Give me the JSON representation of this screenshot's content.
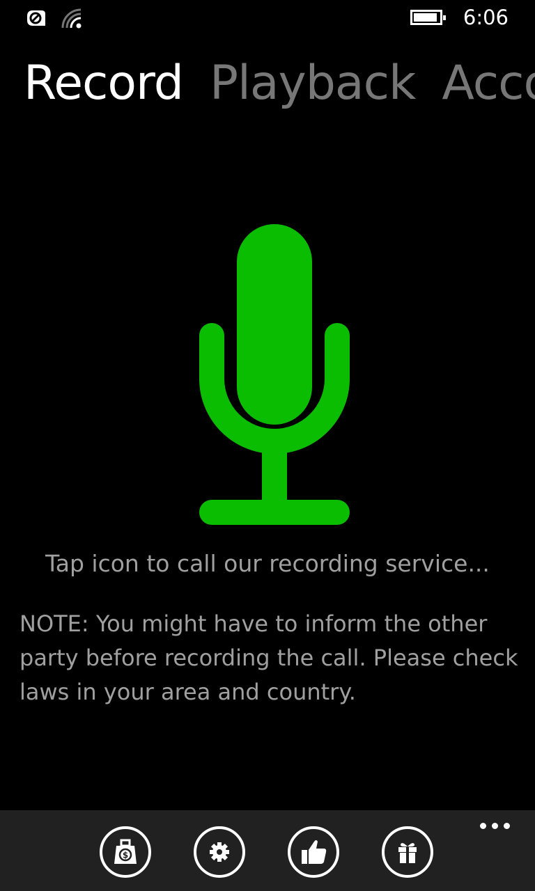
{
  "status_bar": {
    "time": "6:06",
    "icons": [
      "data-sense-icon",
      "wifi-icon",
      "battery-icon"
    ]
  },
  "pivot": {
    "tabs": [
      {
        "label": "Record",
        "active": true
      },
      {
        "label": "Playback",
        "active": false
      },
      {
        "label": "Account",
        "active": false
      }
    ]
  },
  "main": {
    "mic_icon": "microphone-icon",
    "mic_color": "#0bbd00",
    "tap_text": "Tap icon to call our recording service...",
    "note_text": "NOTE: You might have to inform the other party before recording the call. Please check laws in your area and country."
  },
  "app_bar": {
    "background": "#212121",
    "buttons": [
      {
        "icon": "money-bag-icon"
      },
      {
        "icon": "settings-gear-icon"
      },
      {
        "icon": "thumbs-up-icon"
      },
      {
        "icon": "gift-icon"
      }
    ],
    "more_icon": "more-ellipsis-icon"
  }
}
